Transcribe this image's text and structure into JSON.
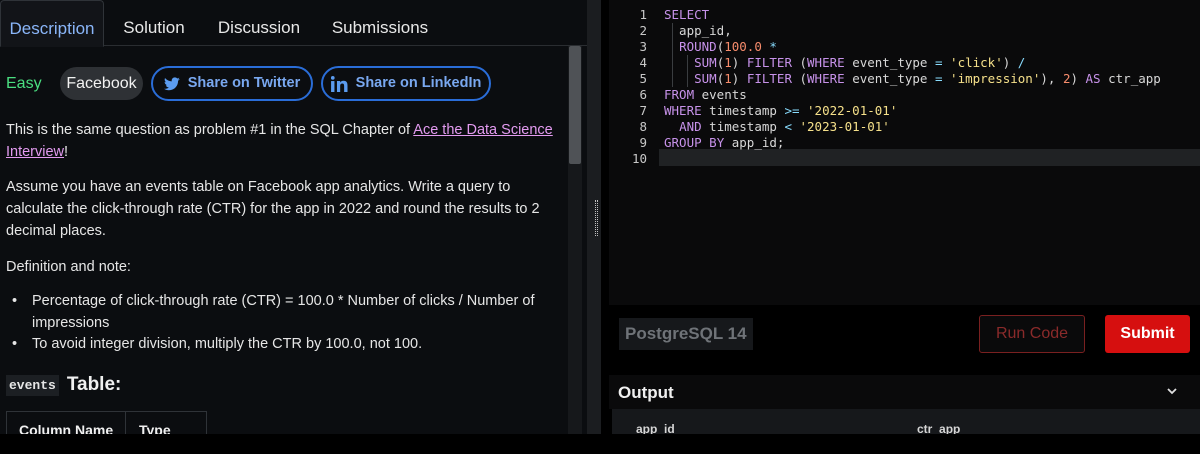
{
  "tabs": [
    "Description",
    "Solution",
    "Discussion",
    "Submissions"
  ],
  "problem": {
    "difficulty": "Easy",
    "company": "Facebook",
    "share_twitter": "Share on Twitter",
    "share_linkedin": "Share on LinkedIn",
    "intro_before": "This is the same question as problem #1 in the SQL Chapter of ",
    "intro_link": "Ace the Data Science Interview",
    "intro_after": "!",
    "description": "Assume you have an events table on Facebook app analytics. Write a query to calculate the click-through rate (CTR) for the app in 2022 and round the results to 2 decimal places.",
    "definition_heading": "Definition and note:",
    "bullets": [
      "Percentage of click-through rate (CTR) = 100.0 * Number of clicks / Number of impressions",
      "To avoid integer division, multiply the CTR by 100.0, not 100."
    ],
    "table_code": "events",
    "table_title": "Table:",
    "table_columns": [
      "Column Name",
      "Type"
    ]
  },
  "editor": {
    "line_numbers": [
      "1",
      "2",
      "3",
      "4",
      "5",
      "6",
      "7",
      "8",
      "9",
      "10"
    ],
    "lines": [
      "SELECT",
      "  app_id,",
      "  ROUND(100.0 *",
      "    SUM(1) FILTER (WHERE event_type = 'click') /",
      "    SUM(1) FILTER (WHERE event_type = 'impression'), 2) AS ctr_app",
      "FROM events",
      "WHERE timestamp >= '2022-01-01'",
      "  AND timestamp < '2023-01-01'",
      "GROUP BY app_id;",
      ""
    ],
    "engine": "PostgreSQL 14",
    "run_label": "Run Code",
    "submit_label": "Submit"
  },
  "output": {
    "title": "Output",
    "columns": [
      "app_id",
      "ctr_app"
    ]
  },
  "colors": {
    "accent_blue": "#8ab6f9",
    "easy_green": "#4ade80",
    "link_pink": "#e39bf0",
    "submit_red": "#d60f0f"
  },
  "icons": [
    "twitter-icon",
    "linkedin-icon",
    "chevron-down-icon",
    "drag-handle-icon"
  ]
}
